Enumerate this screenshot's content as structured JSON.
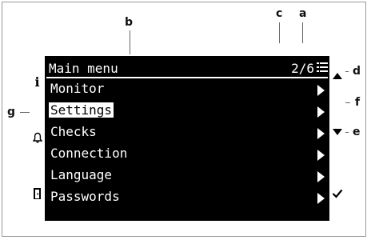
{
  "callouts": {
    "a": "a",
    "b": "b",
    "c": "c",
    "d": "d",
    "e": "e",
    "f": "f",
    "g": "g"
  },
  "screen": {
    "title": "Main menu",
    "page_indicator": "2/6",
    "page_indicator_icon": "list-lines-icon",
    "menu_items": [
      {
        "label": "Monitor",
        "selected": false
      },
      {
        "label": "Settings",
        "selected": true
      },
      {
        "label": "Checks",
        "selected": false
      },
      {
        "label": "Connection",
        "selected": false
      },
      {
        "label": "Language",
        "selected": false
      },
      {
        "label": "Passwords",
        "selected": false
      }
    ],
    "left_icons": {
      "info": "i",
      "bell": "bell-icon",
      "exit": "exit-icon"
    },
    "right_icons": {
      "up": "up-arrow-icon",
      "down": "down-arrow-icon",
      "ok": "checkmark-icon"
    },
    "colors": {
      "background": "#000000",
      "foreground": "#ffffff",
      "sidebar": "#ffffff"
    }
  }
}
